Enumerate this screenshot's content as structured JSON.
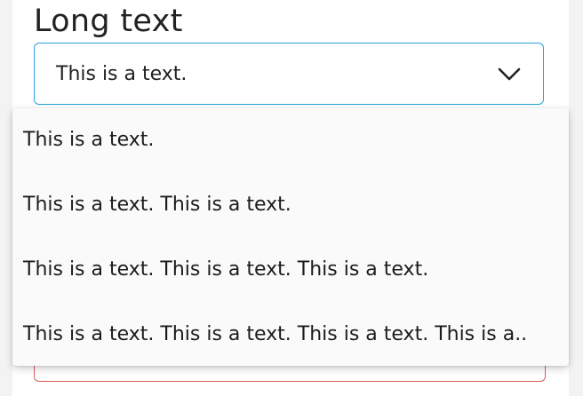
{
  "field": {
    "label": "Long text",
    "selected_value": "This is a text.",
    "chevron_icon": "chevron-down-icon"
  },
  "dropdown": {
    "options": [
      {
        "label": "This is a text."
      },
      {
        "label": "This is a text. This is a text."
      },
      {
        "label": "This is a text. This is a text. This is a text."
      },
      {
        "label": "This is a text. This is a text. This is a text. This is a.."
      }
    ]
  },
  "colors": {
    "focus_border": "#2aa3db",
    "error": "#e05a5a"
  }
}
